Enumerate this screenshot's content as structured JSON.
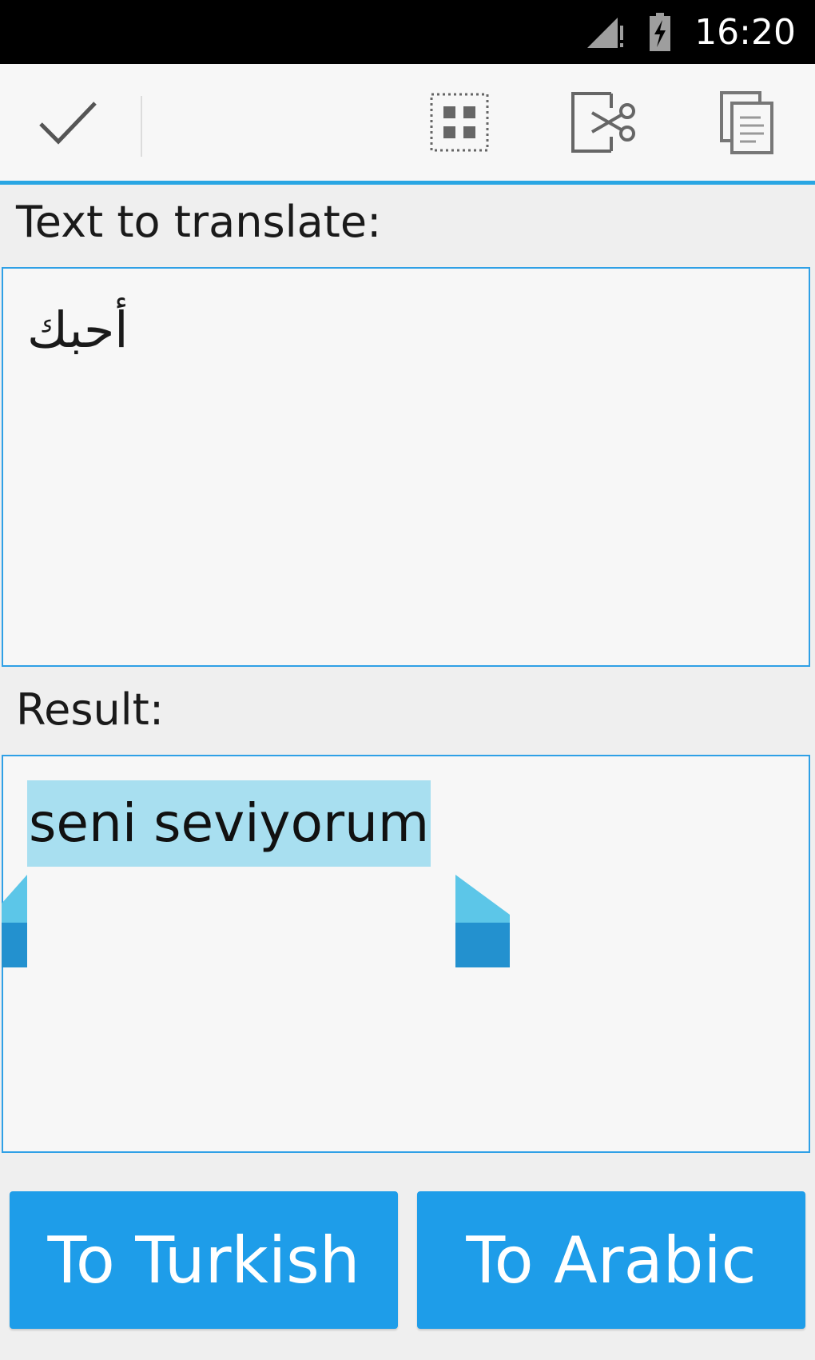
{
  "status_bar": {
    "time": "16:20"
  },
  "action_bar": {
    "icons": [
      "done-icon",
      "select-all-icon",
      "cut-icon",
      "copy-icon"
    ]
  },
  "labels": {
    "text_to_translate": "Text to translate:",
    "result": "Result:"
  },
  "input": {
    "value": "أحبك"
  },
  "result": {
    "value": "seni seviyorum"
  },
  "buttons": {
    "to_turkish": "To Turkish",
    "to_arabic": "To Arabic"
  },
  "colors": {
    "accent": "#1e9de9",
    "selection": "#a8dff0",
    "status_bar": "#000000"
  }
}
